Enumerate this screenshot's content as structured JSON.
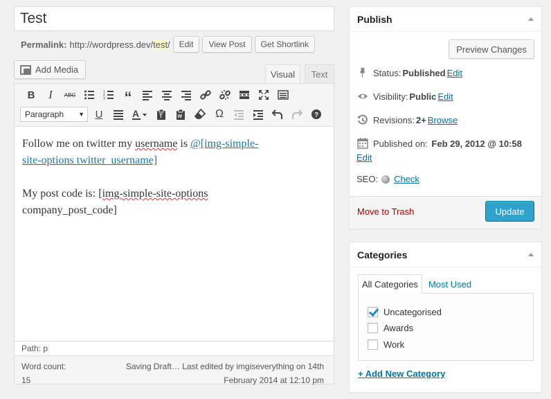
{
  "post": {
    "title": "Test",
    "permalink_label": "Permalink:",
    "permalink_base": "http://wordpress.dev/",
    "permalink_slug": "test",
    "permalink_trailing": "/",
    "edit_label": "Edit",
    "view_post_label": "View Post",
    "get_shortlink_label": "Get Shortlink"
  },
  "editor": {
    "add_media_label": "Add Media",
    "tab_visual": "Visual",
    "tab_text": "Text",
    "format_select_value": "Paragraph",
    "content": {
      "p1_prefix": "Follow me on twitter my ",
      "p1_misspelled": "username",
      "p1_mid": " is ",
      "p1_link_a": "@[img-simple-",
      "p1_link_b": "site-options twitter_username]",
      "p2_prefix": "My p",
      "p2_rest": "ost code is: ",
      "p2_short_a": "[img-simple-site-options",
      "p2_short_b": "company_post_code]"
    },
    "path_label": "Path: p",
    "word_count_label": "Word count:",
    "word_count": "15",
    "saving_line1": "Saving Draft… Last edited by imgiseverything on 14th",
    "saving_line2": "February 2014 at 12:10 pm"
  },
  "publish": {
    "title": "Publish",
    "preview_changes_label": "Preview Changes",
    "status_label": "Status:",
    "status_value": "Published",
    "status_edit": "Edit",
    "visibility_label": "Visibility:",
    "visibility_value": "Public",
    "visibility_edit": "Edit",
    "revisions_label": "Revisions:",
    "revisions_value": "2+",
    "revisions_link": "Browse",
    "published_on_label": "Published on:",
    "published_on_value": "Feb 29, 2012 @ 10:58",
    "published_on_edit": "Edit",
    "seo_label": "SEO:",
    "seo_link": "Check",
    "move_to_trash": "Move to Trash",
    "update_label": "Update"
  },
  "categories": {
    "title": "Categories",
    "tab_all": "All Categories",
    "tab_most_used": "Most Used",
    "items": [
      {
        "label": "Uncategorised",
        "checked": true
      },
      {
        "label": "Awards",
        "checked": false
      },
      {
        "label": "Work",
        "checked": false
      }
    ],
    "add_new_label": "+ Add New Category"
  },
  "colors": {
    "link": "#0074a2",
    "update_button": "#2ea2cc",
    "trash": "#aa0000",
    "slug_highlight": "#fffbcc"
  },
  "icons": {
    "toolbar_row1": [
      "bold-icon",
      "italic-icon",
      "strikethrough-icon",
      "bullet-list-icon",
      "numbered-list-icon",
      "blockquote-icon",
      "align-left-icon",
      "align-center-icon",
      "align-right-icon",
      "insert-link-icon",
      "unlink-icon",
      "read-more-icon",
      "fullscreen-icon",
      "toolbar-toggle-icon"
    ],
    "toolbar_row2": [
      "underline-icon",
      "align-justify-icon",
      "text-color-icon",
      "paste-as-text-icon",
      "paste-from-word-icon",
      "clear-formatting-icon",
      "special-character-icon",
      "outdent-icon",
      "indent-icon",
      "undo-icon",
      "redo-icon",
      "help-icon"
    ]
  }
}
